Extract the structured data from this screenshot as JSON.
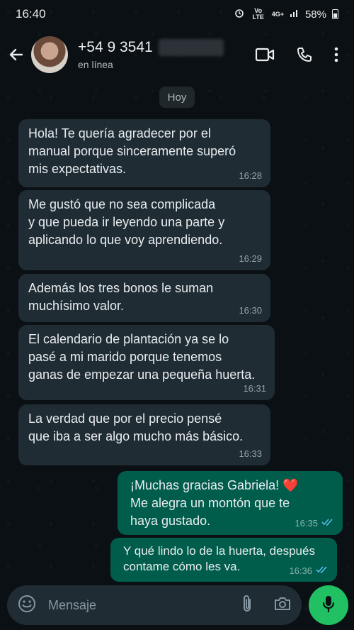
{
  "status_bar": {
    "time": "16:40",
    "network": "Vo LTE",
    "signal": "4G+",
    "battery": "58%"
  },
  "header": {
    "phone_prefix": "+54 9 3541",
    "status": "en línea"
  },
  "date_chip": "Hoy",
  "messages": [
    {
      "text": "Hola! Te quería agradecer por el\nmanual porque sinceramente superó\nmis expectativas.",
      "time": "16:28"
    },
    {
      "text": "Me gustó que no sea complicada\ny que pueda ir leyendo una parte y\naplicando lo que voy aprendiendo.",
      "time": "16:29"
    },
    {
      "text": "Además los tres bonos le suman\nmuchísimo valor.",
      "time": "16:30"
    },
    {
      "text": "El calendario de plantación ya se lo\npasé a mi marido porque tenemos\nganas de empezar una pequeña huerta.",
      "time": "16:31"
    },
    {
      "text": "La verdad que por el precio pensé\nque iba a ser algo mucho más básico.",
      "time": "16:33"
    },
    {
      "text": "¡Muchas gracias Gabriela! ❤️\nMe alegra un montón que te\nhaya gustado.",
      "time": "16:35"
    },
    {
      "text": "Y qué lindo lo de la huerta, después\ncontame cómo les va.",
      "time": "16:36"
    }
  ],
  "composer": {
    "placeholder": "Mensaje"
  },
  "colors": {
    "incoming": "#1f2c33",
    "outgoing": "#005c4b",
    "accent": "#21c063",
    "read_ticks": "#53bdeb"
  }
}
